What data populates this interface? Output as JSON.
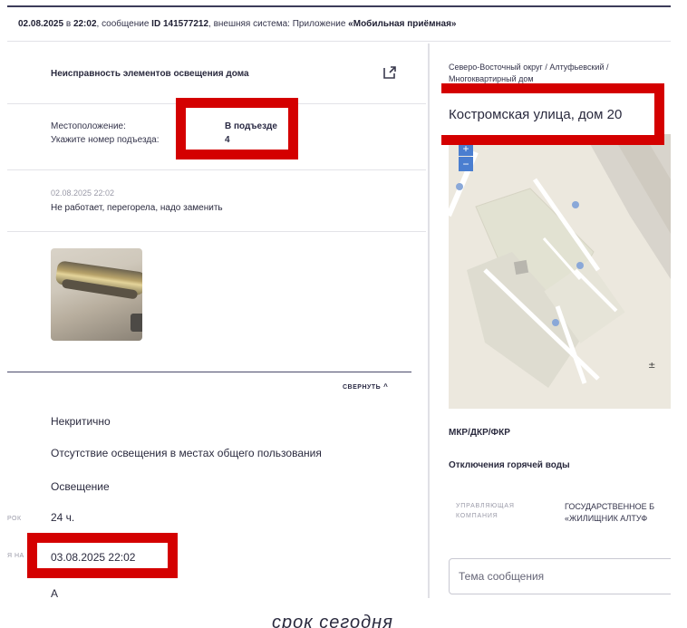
{
  "header": {
    "date": "02.08.2025",
    "in_word": "в",
    "time": "22:02",
    "message_word": ", сообщение",
    "message_id": "ID 141577212",
    "system_text": ", внешняя система: Приложение",
    "system_name": "«Мобильная приёмная»"
  },
  "issue": {
    "title": "Неисправность элементов освещения дома",
    "location_label": "Местоположение:",
    "location_value": "В подъезде",
    "entrance_label": "Укажите номер подъезда:",
    "entrance_value": "4"
  },
  "comment": {
    "date": "02.08.2025 22:02",
    "text": "Не работает, перегорела, надо заменить"
  },
  "details": {
    "collapse_label": "СВЕРНУТЬ",
    "criticality": "Некритично",
    "problem": "Отсутствие освещения в местах общего пользования",
    "category": "Освещение",
    "deadline_label_partial": "РОК",
    "deadline": "24 ч.",
    "date_label_partial": "Я НА",
    "due_date": "03.08.2025 22:02",
    "cut_text": "А"
  },
  "address": {
    "district_line1": "Северо-Восточный округ / Алтуфьевский /",
    "district_line2": "Многоквартирный дом",
    "street": "Костромская улица, дом 20"
  },
  "map": {
    "zoom_in": "+",
    "zoom_out": "−"
  },
  "right_info": {
    "mkr": "МКР/ДКР/ФКР",
    "hot_water": "Отключения горячей воды",
    "mc_label_line1": "УПРАВЛЯЮЩАЯ",
    "mc_label_line2": "КОМПАНИЯ",
    "mc_value_line1": "ГОСУДАРСТВЕННОЕ Б",
    "mc_value_line2": "«ЖИЛИЩНИК АЛТУФ",
    "message_placeholder": "Тема сообщения"
  },
  "caption": "срок сегодня",
  "colors": {
    "highlight": "#d40000",
    "accent": "#3c3c5a",
    "map_button": "#4a7ed0"
  }
}
